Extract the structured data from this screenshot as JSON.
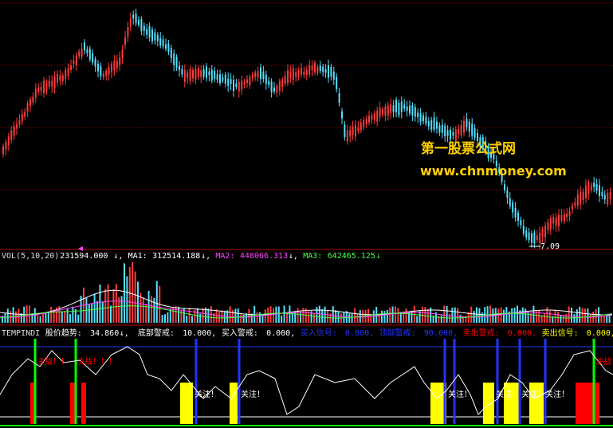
{
  "watermark": {
    "line1": "第一股票公式网",
    "line2": "www.chnmoney.com"
  },
  "price_panel": {
    "low_label": "7.09"
  },
  "vol_panel": {
    "name": "VOL(5,10,20)",
    "value": "231594.000",
    "ma1_label": "MA1:",
    "ma1_value": "312514.188",
    "ma2_label": "MA2:",
    "ma2_value": "448066.313",
    "ma3_label": "MA3:",
    "ma3_value": "642465.125",
    "arrow": "↓"
  },
  "indicator_panel": {
    "name": "TEMPINDI",
    "trend_label": "股价趋势:",
    "trend_value": "34.860",
    "bottom_warn_label": "底部警戒:",
    "bottom_warn_value": "10.000",
    "buy_warn_label": "买入警戒:",
    "buy_warn_value": "0.000",
    "buy_signal_label": "买入信号:",
    "buy_signal_value": "0.000",
    "top_warn_label": "顶部警戒:",
    "top_warn_value": "90.000",
    "sell_warn_label": "卖出警戒:",
    "sell_warn_value": "0.000",
    "sell_signal_label": "卖出信号:",
    "sell_signal_value": "0.000",
    "text_bottom_left": "决战！！",
    "text_bottom_left2": "决战！！！",
    "text_focus": "关注！",
    "text_right": "决战"
  },
  "colors": {
    "up": "#ff3b3b",
    "down": "#54e0ff",
    "grid": "#7a0000",
    "ma1": "#ffffff",
    "ma2": "#ff44ff",
    "ma3": "#44ff44",
    "yellow": "#ffff00",
    "red": "#ff0000",
    "green": "#00ff00",
    "blue": "#2233ff"
  }
}
